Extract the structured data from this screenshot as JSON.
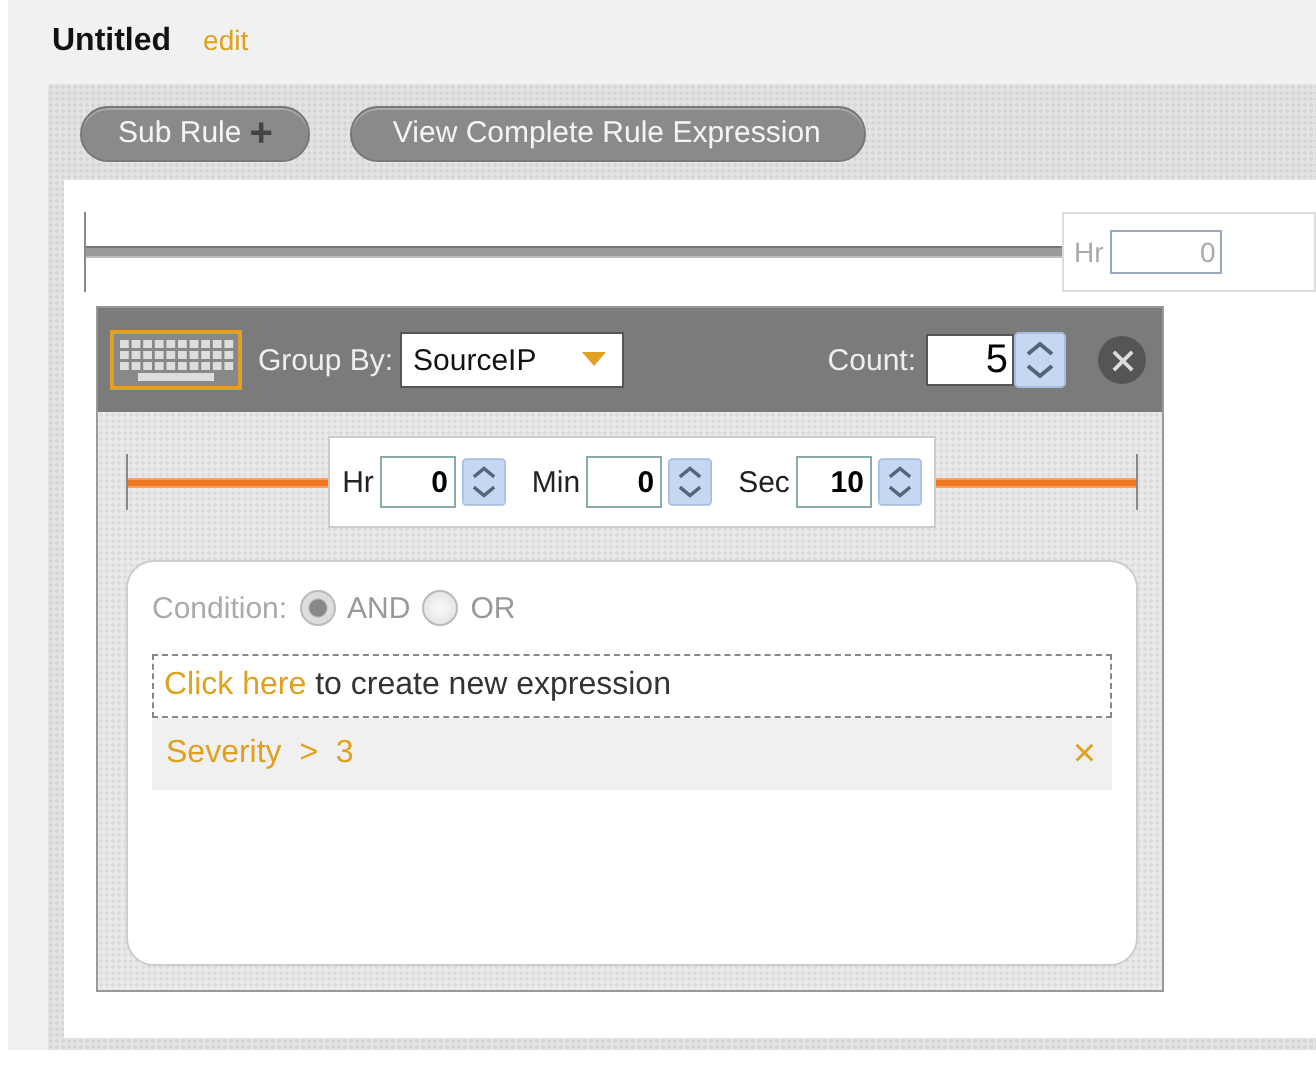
{
  "title": "Untitled",
  "edit_link": "edit",
  "toolbar": {
    "sub_rule": "Sub Rule",
    "sub_rule_icon": "+",
    "view_expression": "View Complete Rule Expression"
  },
  "side_timer": {
    "hr_label": "Hr",
    "hr_value": "0"
  },
  "group": {
    "group_by_label": "Group By:",
    "group_by_value": "SourceIP",
    "count_label": "Count:",
    "count_value": "5",
    "timer": [
      {
        "label": "Hr",
        "value": "0"
      },
      {
        "label": "Min",
        "value": "0"
      },
      {
        "label": "Sec",
        "value": "10"
      }
    ],
    "condition": {
      "label": "Condition:",
      "options": [
        {
          "label": "AND",
          "selected": true
        },
        {
          "label": "OR",
          "selected": false
        }
      ],
      "create_link": "Click here",
      "create_text": "to create new expression",
      "expressions": [
        {
          "text": "Severity  >  3",
          "remove": "×"
        }
      ]
    }
  }
}
